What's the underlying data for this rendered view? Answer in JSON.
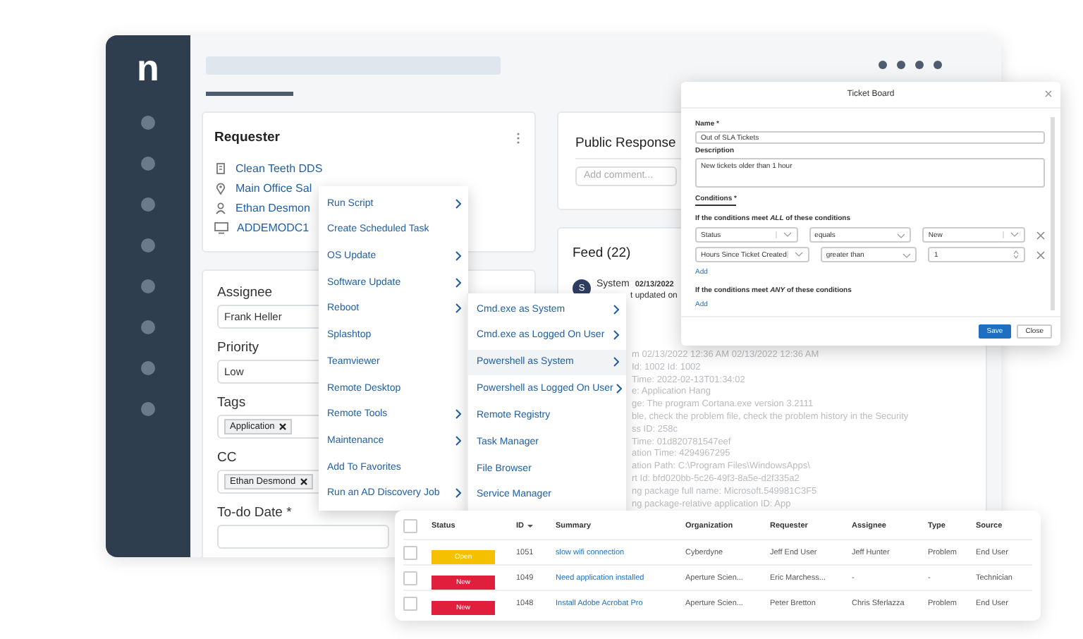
{
  "sidebar": {
    "logo": "n"
  },
  "requester": {
    "title": "Requester",
    "items": [
      {
        "kind": "organization",
        "text": "Clean Teeth DDS"
      },
      {
        "kind": "location",
        "text": "Main Office Sal"
      },
      {
        "kind": "person",
        "text": "Ethan Desmon"
      },
      {
        "kind": "device",
        "text": "ADDEMODC1"
      }
    ]
  },
  "assignment": {
    "fields": [
      {
        "kind": "select",
        "label": "Assignee",
        "value": "Frank Heller"
      },
      {
        "kind": "select",
        "label": "Priority",
        "value": "Low"
      },
      {
        "kind": "tags",
        "label": "Tags",
        "tags": [
          "Application"
        ]
      },
      {
        "kind": "tags",
        "label": "CC",
        "tags": [
          "Ethan Desmond"
        ]
      },
      {
        "kind": "date",
        "label": "To-do Date *"
      }
    ]
  },
  "public_response": {
    "title": "Public Response",
    "placeholder": "Add comment..."
  },
  "feed": {
    "title": "Feed (22)",
    "entry": {
      "avatar": "S",
      "author": "System",
      "date": "02/13/2022",
      "text": "t updated on"
    },
    "log_lines": [
      "m  02/13/2022 12:36 AM   02/13/2022 12:36 AM",
      "Id: 1002          Id: 1002",
      "Time: 2022-02-13T01:34:02",
      "e: Application Hang",
      "ge: The program Cortana.exe version 3.2111",
      "ble, check the problem file, check the problem history in the Security",
      "ss ID: 258c",
      "Time: 01d820781547eef",
      "ation Time: 4294967295",
      "ation Path: C:\\Program Files\\WindowsApps\\",
      "rt Id: bfd020bb-5c26-49f3-8a5e-d2f335a2",
      "ng package full name: Microsoft.549981C3F5",
      "ng package-relative application ID: App"
    ]
  },
  "context_menu": {
    "items": [
      {
        "label": "Run Script",
        "submenu": true
      },
      {
        "label": "Create Scheduled Task",
        "submenu": false
      },
      {
        "label": "OS Update",
        "submenu": true
      },
      {
        "label": "Software Update",
        "submenu": true
      },
      {
        "label": "Reboot",
        "submenu": true
      },
      {
        "label": "Splashtop",
        "submenu": false
      },
      {
        "label": "Teamviewer",
        "submenu": false
      },
      {
        "label": "Remote Desktop",
        "submenu": false
      },
      {
        "label": "Remote Tools",
        "submenu": true
      },
      {
        "label": "Maintenance",
        "submenu": true
      },
      {
        "label": "Add To Favorites",
        "submenu": false
      },
      {
        "label": "Run an AD Discovery Job",
        "submenu": true
      }
    ],
    "submenu": {
      "items": [
        {
          "label": "Cmd.exe as System",
          "submenu": true,
          "selected": false
        },
        {
          "label": "Cmd.exe as Logged On User",
          "submenu": true,
          "selected": false
        },
        {
          "label": "Powershell as System",
          "submenu": true,
          "selected": true
        },
        {
          "label": "Powershell as Logged On User",
          "submenu": true,
          "selected": false
        },
        {
          "label": "Remote Registry",
          "submenu": false,
          "selected": false
        },
        {
          "label": "Task Manager",
          "submenu": false,
          "selected": false
        },
        {
          "label": "File Browser",
          "submenu": false,
          "selected": false
        },
        {
          "label": "Service Manager",
          "submenu": false,
          "selected": false
        }
      ]
    }
  },
  "ticket_board": {
    "title": "Ticket Board",
    "name_label": "Name *",
    "name_value": "Out of SLA Tickets",
    "description_label": "Description",
    "description_value": "New tickets older than 1 hour",
    "conditions_tab": "Conditions *",
    "all_heading": "If the conditions meet *ALL* of these conditions",
    "conditions": [
      {
        "kind": "select",
        "field": "Status",
        "operator": "equals",
        "value": "New"
      },
      {
        "kind": "number",
        "field": "Hours Since Ticket Created",
        "operator": "greater than",
        "value": "1"
      }
    ],
    "add_all": "Add",
    "any_heading": "If the conditions meet *ANY* of these conditions",
    "add_any": "Add",
    "save": "Save",
    "close": "Close"
  },
  "tickets": {
    "all_checked": false,
    "columns": [
      "Status",
      "ID",
      "Summary",
      "Organization",
      "Requester",
      "Assignee",
      "Type",
      "Source"
    ],
    "rows": [
      {
        "checked": false,
        "status": "Open",
        "color": "#f5c000",
        "id": "1051",
        "summary": "slow wifi connection",
        "organization": "Cyberdyne",
        "requester": "Jeff End User",
        "assignee": "Jeff Hunter",
        "type": "Problem",
        "source": "End User"
      },
      {
        "checked": false,
        "status": "New",
        "color": "#e01f3d",
        "id": "1049",
        "summary": "Need application installed",
        "organization": "Aperture Scien...",
        "requester": "Eric Marchess...",
        "assignee": "-",
        "type": "-",
        "source": "Technician"
      },
      {
        "checked": false,
        "status": "New",
        "color": "#e01f3d",
        "id": "1048",
        "summary": "Install Adobe Acrobat Pro",
        "organization": "Aperture Scien...",
        "requester": "Peter Bretton",
        "assignee": "Chris Sferlazza",
        "type": "Problem",
        "source": "End User"
      }
    ]
  }
}
